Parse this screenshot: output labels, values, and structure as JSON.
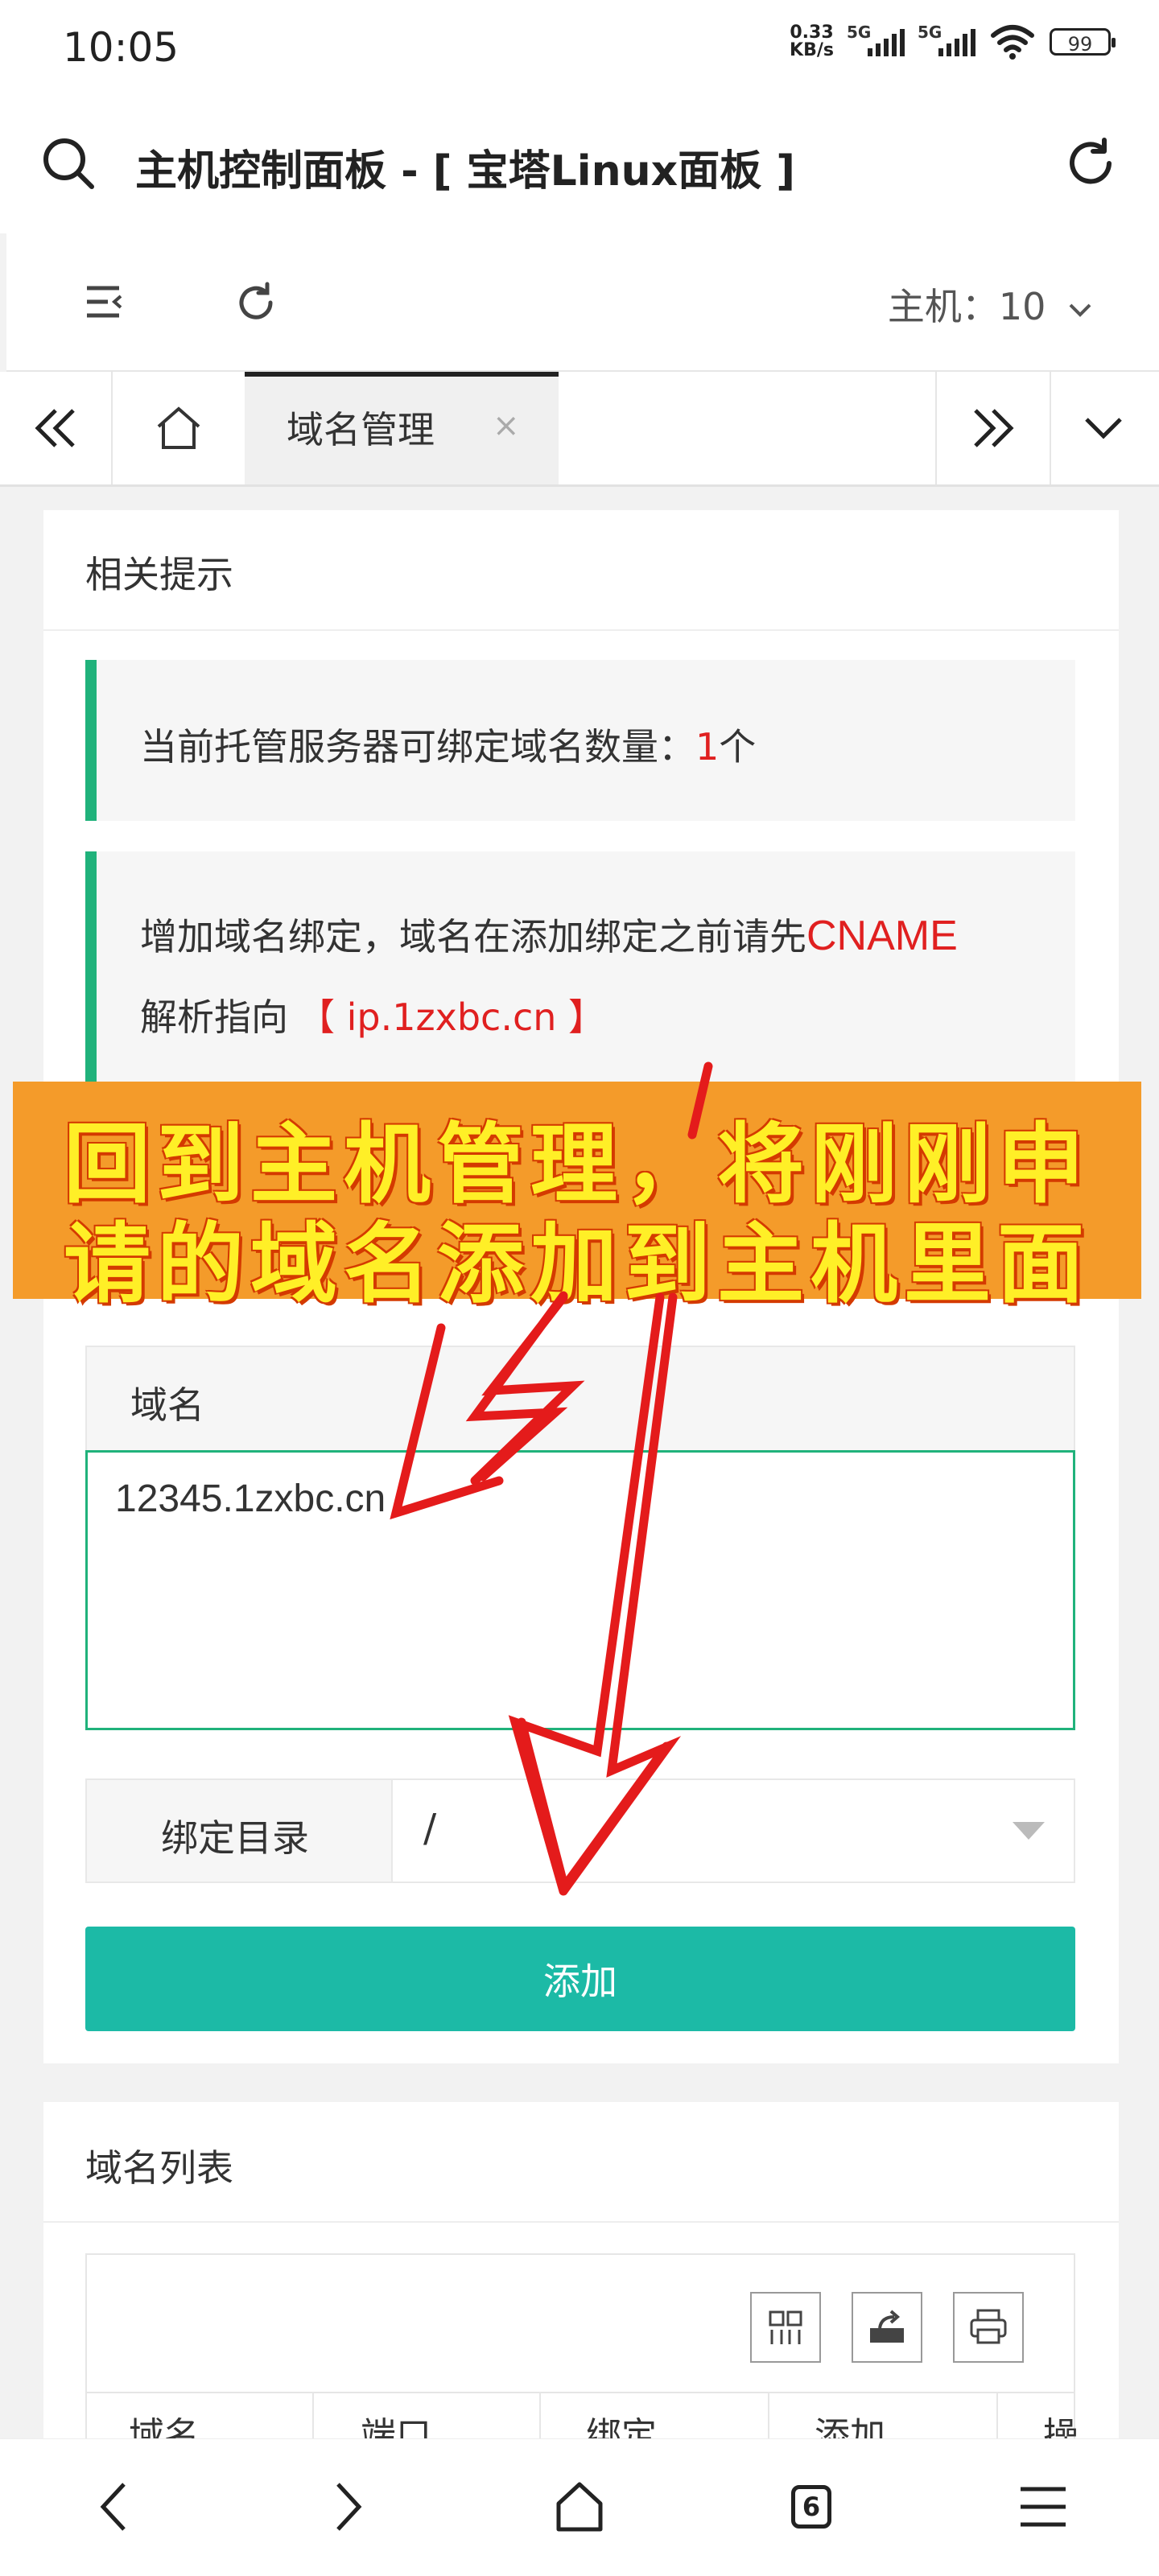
{
  "status_bar": {
    "time": "10:05",
    "net_speed_value": "0.33",
    "net_speed_unit": "KB/s",
    "signal1_label": "5G",
    "signal2_label": "5G",
    "battery": "99"
  },
  "browser": {
    "title": "主机控制面板 - [ 宝塔Linux面板 ]"
  },
  "toolbar": {
    "host_label": "主机：10"
  },
  "tabs": {
    "active_label": "域名管理",
    "close_glyph": "×"
  },
  "tips_card": {
    "title": "相关提示",
    "tip1_prefix": "当前托管服务器可绑定域名数量：",
    "tip1_count": "1",
    "tip1_suffix": "个",
    "tip2_prefix": "增加域名绑定，域名在添加绑定之前请先",
    "tip2_cname": "CNAME",
    "tip2_line2_prefix": "解析指向",
    "tip2_target": "【 ip.1zxbc.cn 】"
  },
  "overlay": {
    "line1": "回到主机管理，将刚刚申",
    "line2": "请的域名添加到主机里面"
  },
  "domain_form": {
    "label": "域名",
    "value": "12345.1zxbc.cn",
    "bind_label": "绑定目录",
    "bind_value": "/",
    "add_button": "添加"
  },
  "domain_list": {
    "title": "域名列表",
    "columns": [
      "域名",
      "端口",
      "绑定",
      "添加",
      "操"
    ]
  },
  "colors": {
    "accent_green": "#20b27b",
    "button_teal": "#1cbaa6",
    "highlight_red": "#e02020",
    "banner_orange": "#f49b2a",
    "banner_text": "#ffef27"
  },
  "icons": [
    "search-icon",
    "refresh-icon",
    "menu-collapse-icon",
    "chevron-down-icon",
    "double-left-icon",
    "home-icon",
    "double-right-icon",
    "grid-icon",
    "export-icon",
    "print-icon",
    "back-icon",
    "forward-icon",
    "home-nav-icon",
    "menu-icon"
  ]
}
